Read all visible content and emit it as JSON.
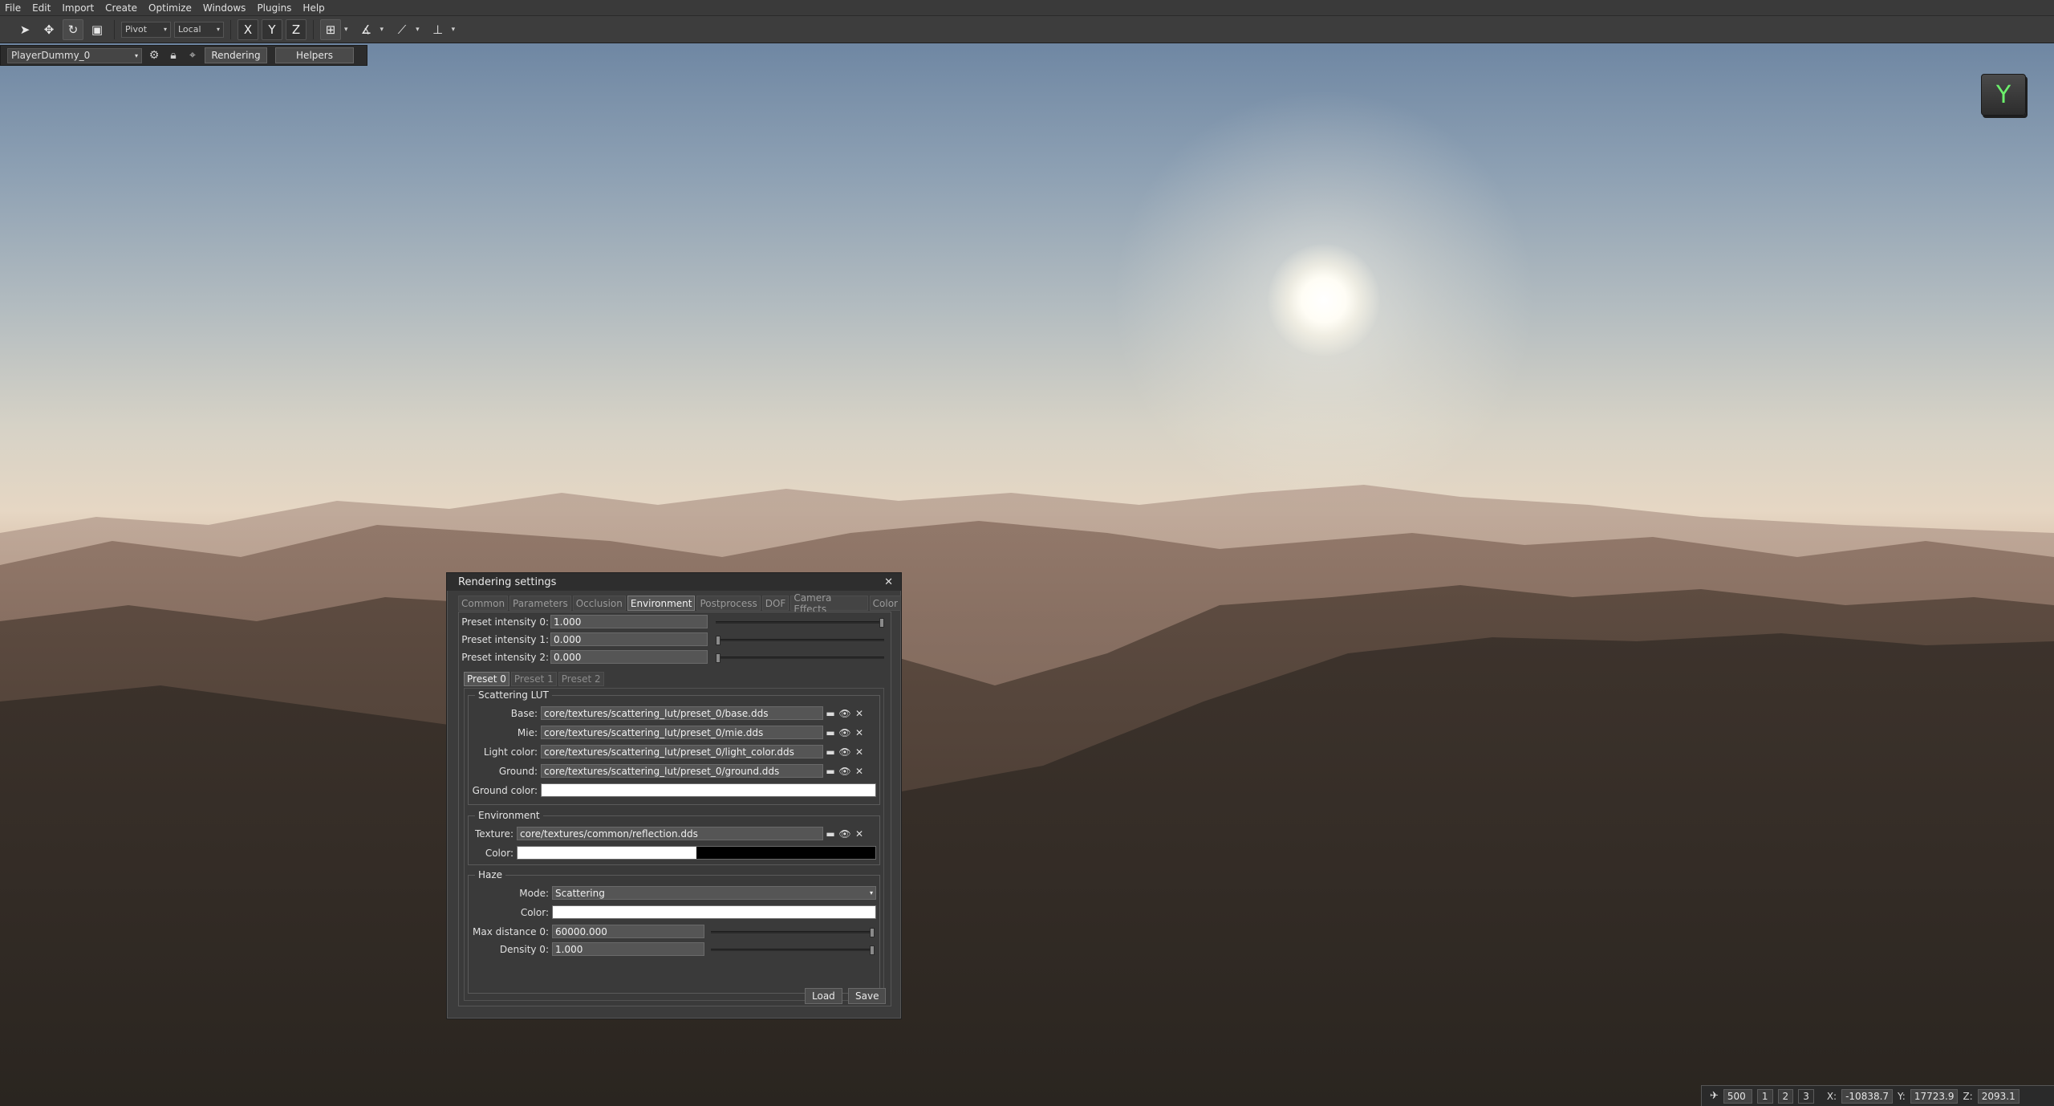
{
  "menu": [
    "File",
    "Edit",
    "Import",
    "Create",
    "Optimize",
    "Windows",
    "Plugins",
    "Help"
  ],
  "toolbar": {
    "pivot": "Pivot",
    "space": "Local",
    "axes": [
      "X",
      "Y",
      "Z"
    ]
  },
  "subbar": {
    "player": "PlayerDummy_0",
    "rendering": "Rendering",
    "helpers": "Helpers"
  },
  "gizmo": {
    "label": "Y",
    "color": "#6cf06c"
  },
  "status": {
    "speed": "500",
    "views": [
      "1",
      "2",
      "3"
    ],
    "x_label": "X:",
    "x": "-10838.7",
    "y_label": "Y:",
    "y": "17723.9",
    "z_label": "Z:",
    "z": "2093.1"
  },
  "dialog": {
    "title": "Rendering settings",
    "tabs": [
      "Common",
      "Parameters",
      "Occlusion",
      "Environment",
      "Postprocess",
      "DOF",
      "Camera Effects",
      "Color"
    ],
    "active_tab": "Environment",
    "presets": [
      {
        "label": "Preset intensity 0:",
        "value": "1.000",
        "level": 1.0
      },
      {
        "label": "Preset intensity 1:",
        "value": "0.000",
        "level": 0.0
      },
      {
        "label": "Preset intensity 2:",
        "value": "0.000",
        "level": 0.0
      }
    ],
    "preset_tabs": [
      "Preset 0",
      "Preset 1",
      "Preset 2"
    ],
    "scattering": {
      "title": "Scattering LUT",
      "rows": [
        {
          "label": "Base:",
          "value": "core/textures/scattering_lut/preset_0/base.dds"
        },
        {
          "label": "Mie:",
          "value": "core/textures/scattering_lut/preset_0/mie.dds"
        },
        {
          "label": "Light color:",
          "value": "core/textures/scattering_lut/preset_0/light_color.dds"
        },
        {
          "label": "Ground:",
          "value": "core/textures/scattering_lut/preset_0/ground.dds"
        }
      ],
      "ground_color_label": "Ground color:"
    },
    "environment": {
      "title": "Environment",
      "texture_label": "Texture:",
      "texture": "core/textures/common/reflection.dds",
      "color_label": "Color:"
    },
    "haze": {
      "title": "Haze",
      "mode_label": "Mode:",
      "mode": "Scattering",
      "color_label": "Color:",
      "max_distance_label": "Max distance 0:",
      "max_distance": "60000.000",
      "density_label": "Density 0:",
      "density": "1.000"
    },
    "load": "Load",
    "save": "Save"
  }
}
